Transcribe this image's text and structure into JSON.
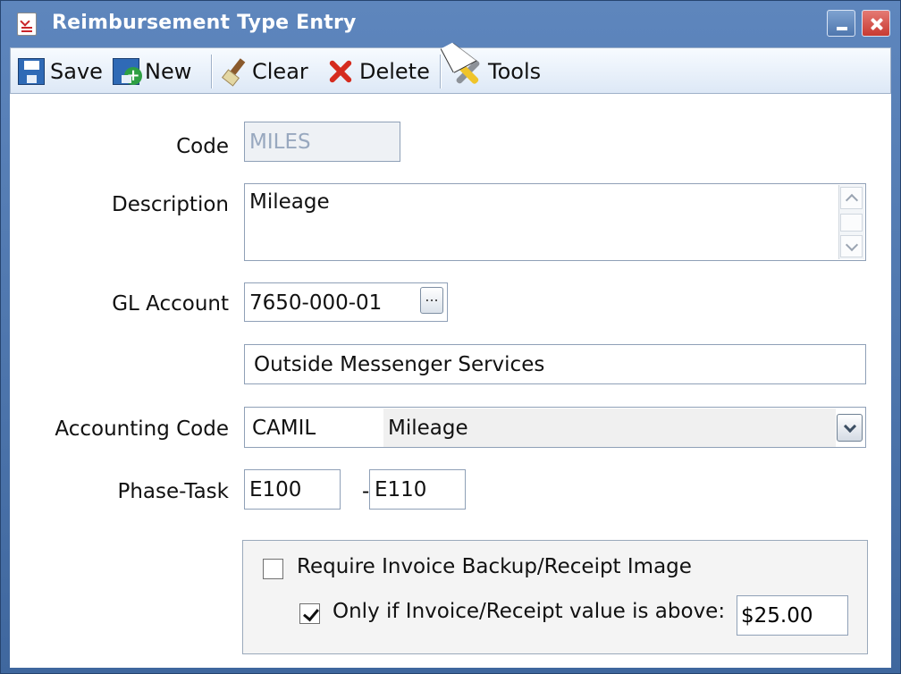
{
  "window": {
    "title": "Reimbursement Type Entry"
  },
  "toolbar": {
    "save": "Save",
    "new": "New",
    "clear": "Clear",
    "delete": "Delete",
    "tools": "Tools"
  },
  "form": {
    "code": {
      "label": "Code",
      "value": "MILES"
    },
    "description": {
      "label": "Description",
      "value": "Mileage"
    },
    "gl_account": {
      "label": "GL Account",
      "value": "7650-000-01",
      "button": "...",
      "description": "Outside Messenger Services"
    },
    "accounting_code": {
      "label": "Accounting Code",
      "code": "CAMIL",
      "value": "Mileage"
    },
    "phase_task": {
      "label": "Phase-Task",
      "phase": "E100",
      "separator": "-",
      "task": "E110"
    },
    "backup": {
      "require_label": "Require Invoice Backup/Receipt Image",
      "require_checked": false,
      "threshold_label": "Only if Invoice/Receipt value is above:",
      "threshold_checked": true,
      "threshold_value": "$25.00"
    }
  },
  "icons": {
    "app": "reimbursement-form-icon",
    "save": "floppy-disk-icon",
    "new": "new-floppy-icon",
    "clear": "broom-icon",
    "delete": "delete-x-icon",
    "tools": "tools-icon"
  },
  "colors": {
    "titlebar": "#4d76ad",
    "toolbar": "#e8f0fb",
    "close": "#c73a32",
    "delete": "#d52b1e"
  }
}
